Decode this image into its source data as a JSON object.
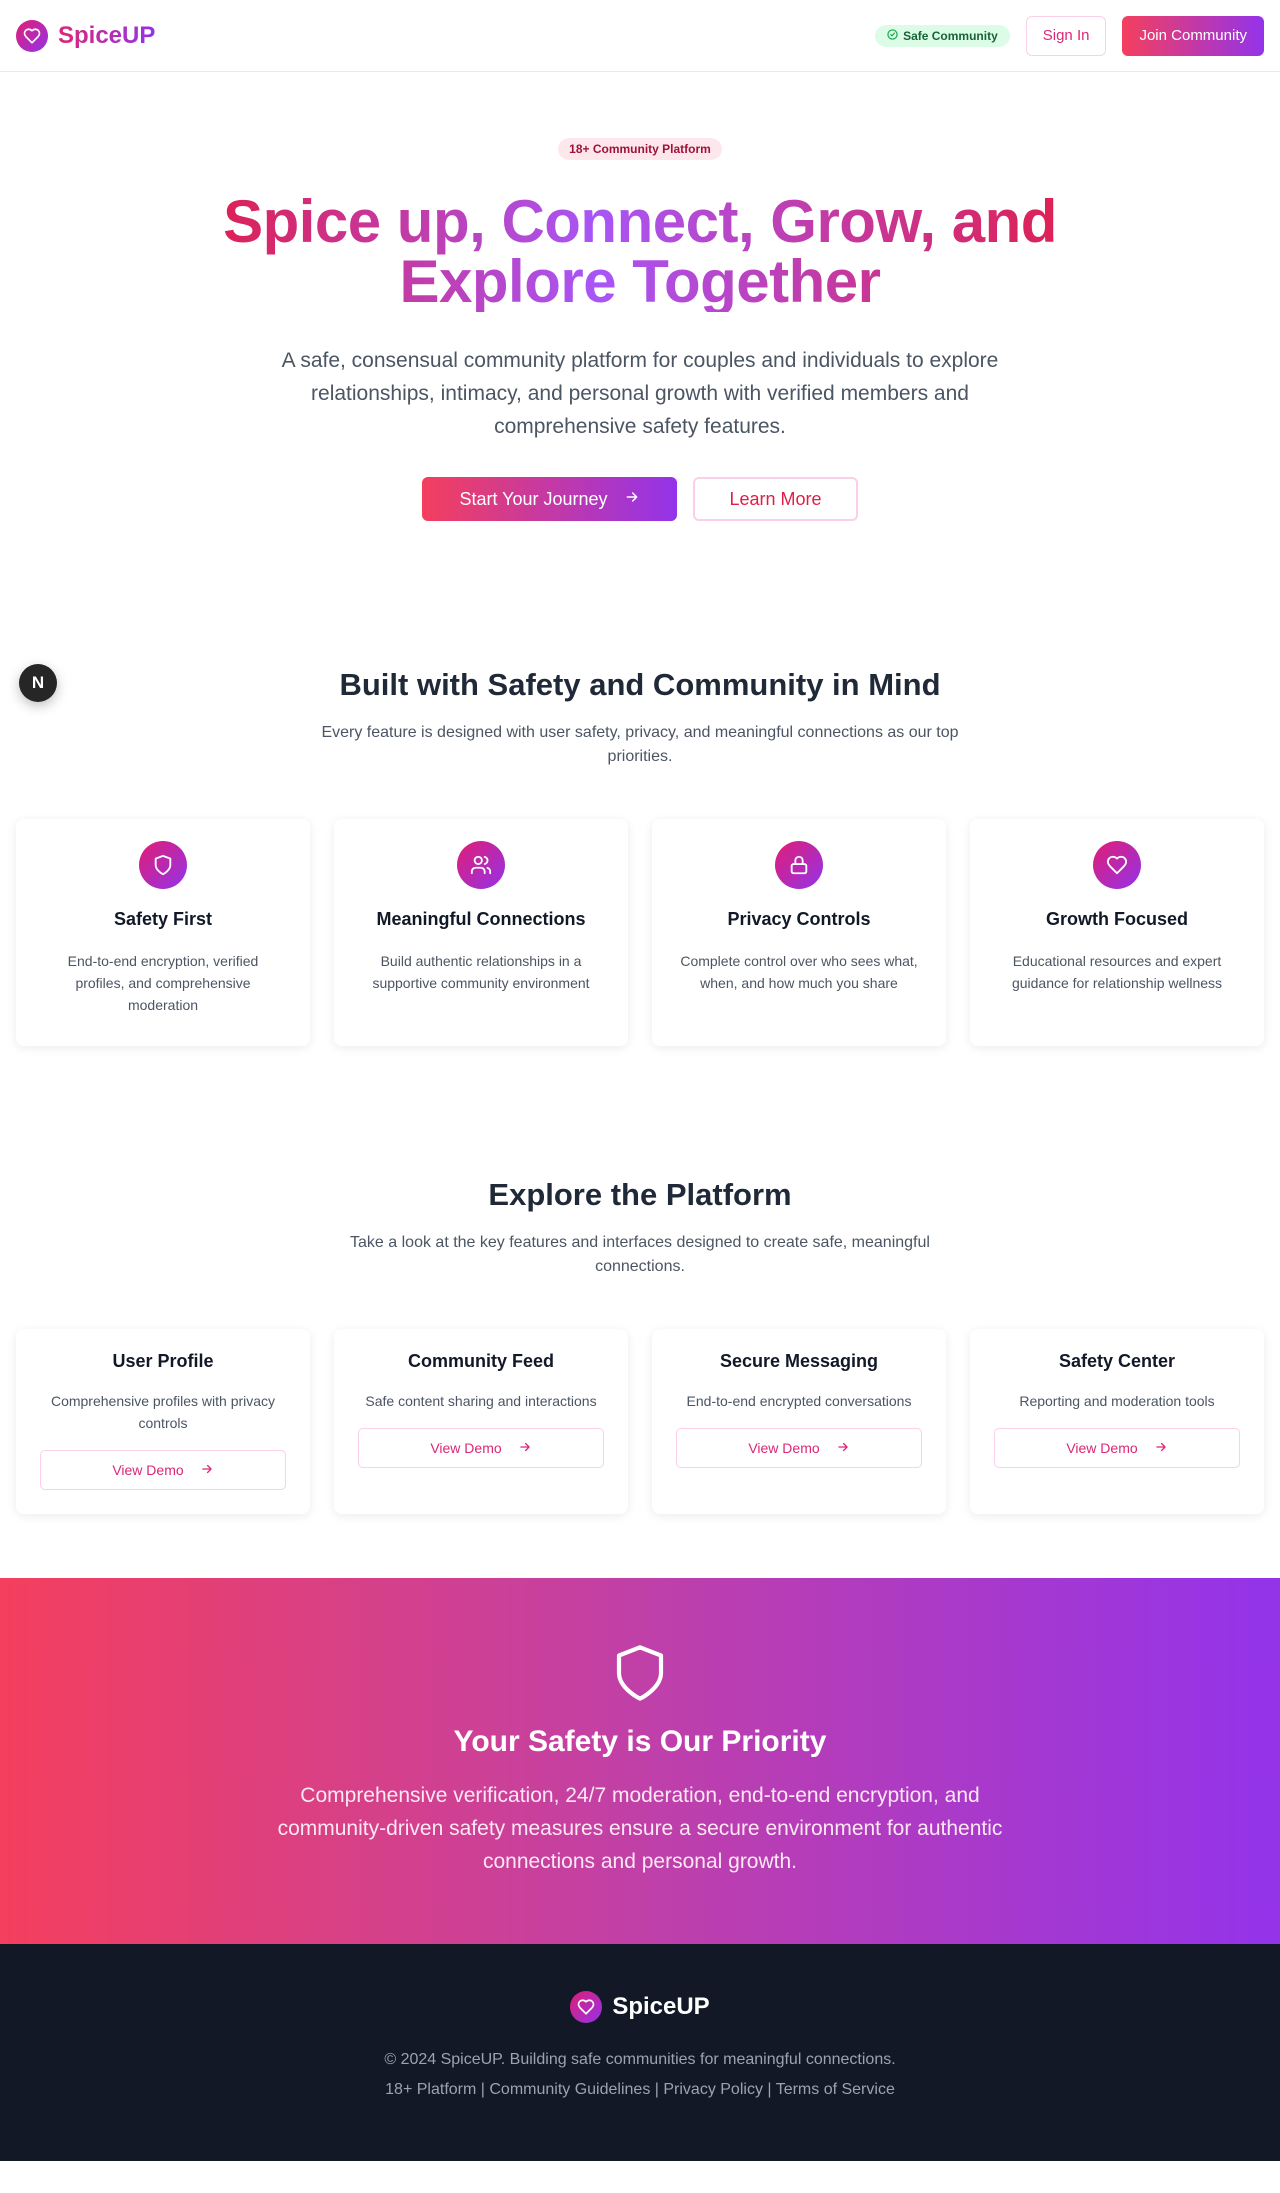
{
  "header": {
    "brand": "SpiceUP",
    "safe_badge": "Safe Community",
    "sign_in": "Sign In",
    "join": "Join Community"
  },
  "hero": {
    "pill": "18+ Community Platform",
    "title": "Spice up, Connect, Grow, and Explore Together",
    "subtitle": "A safe, consensual community platform for couples and individuals to explore relationships, intimacy, and personal growth with verified members and comprehensive safety features.",
    "primary_cta": "Start Your Journey",
    "secondary_cta": "Learn More"
  },
  "dev_badge": "N",
  "features": {
    "title": "Built with Safety and Community in Mind",
    "subtitle": "Every feature is designed with user safety, privacy, and meaningful connections as our top priorities.",
    "items": [
      {
        "icon": "shield-icon",
        "title": "Safety First",
        "desc": "End-to-end encryption, verified profiles, and comprehensive moderation"
      },
      {
        "icon": "users-icon",
        "title": "Meaningful Connections",
        "desc": "Build authentic relationships in a supportive community environment"
      },
      {
        "icon": "lock-icon",
        "title": "Privacy Controls",
        "desc": "Complete control over who sees what, when, and how much you share"
      },
      {
        "icon": "heart-icon",
        "title": "Growth Focused",
        "desc": "Educational resources and expert guidance for relationship wellness"
      }
    ]
  },
  "explore": {
    "title": "Explore the Platform",
    "subtitle": "Take a look at the key features and interfaces designed to create safe, meaningful connections.",
    "items": [
      {
        "title": "User Profile",
        "desc": "Comprehensive profiles with privacy controls",
        "cta": "View Demo"
      },
      {
        "title": "Community Feed",
        "desc": "Safe content sharing and interactions",
        "cta": "View Demo"
      },
      {
        "title": "Secure Messaging",
        "desc": "End-to-end encrypted conversations",
        "cta": "View Demo"
      },
      {
        "title": "Safety Center",
        "desc": "Reporting and moderation tools",
        "cta": "View Demo"
      }
    ]
  },
  "safety": {
    "title": "Your Safety is Our Priority",
    "text": "Comprehensive verification, 24/7 moderation, end-to-end encryption, and community-driven safety measures ensure a secure environment for authentic connections and personal growth."
  },
  "footer": {
    "brand": "SpiceUP",
    "copyright": "© 2024 SpiceUP. Building safe communities for meaningful connections.",
    "links": "18+ Platform | Community Guidelines | Privacy Policy | Terms of Service"
  },
  "colors": {
    "brand_pink": "#db2777",
    "brand_purple": "#9333ea",
    "brand_rose": "#f43f5e",
    "footer_bg": "#121826"
  }
}
